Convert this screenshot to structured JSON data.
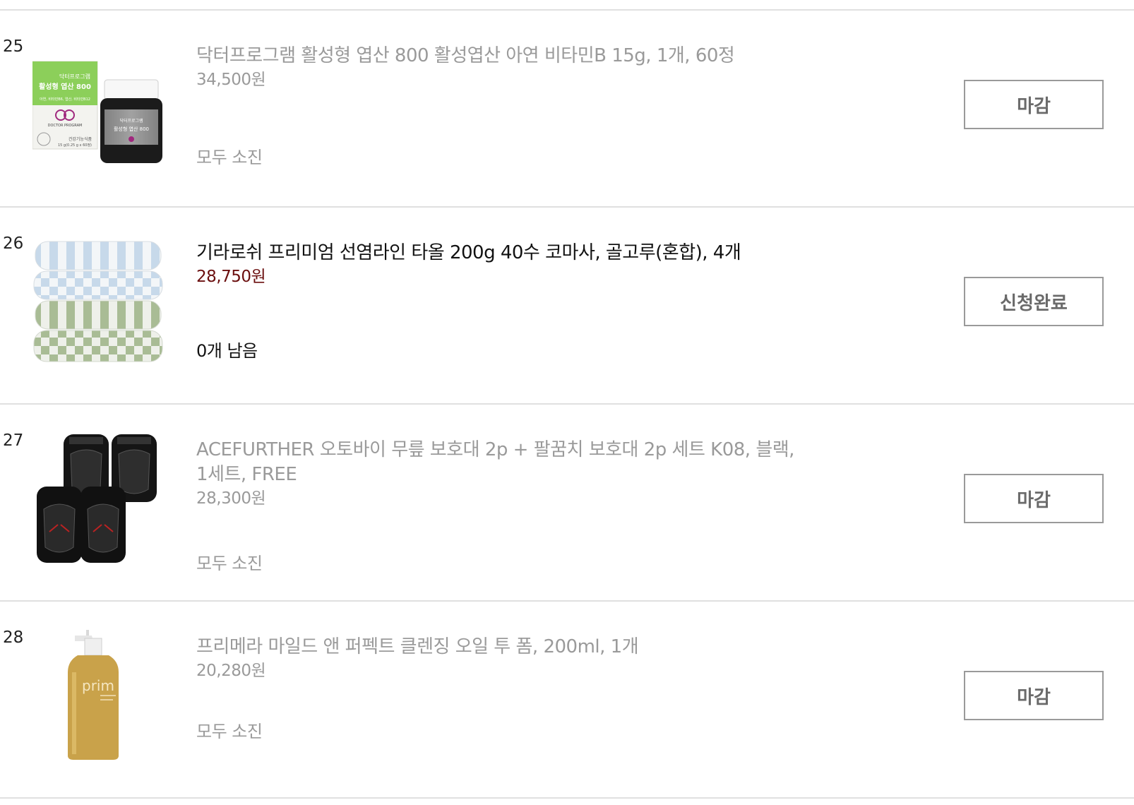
{
  "items": [
    {
      "rank": "25",
      "title": "닥터프로그램 활성형 엽산 800 활성엽산 아연 비타민B 15g, 1개, 60정",
      "price": "34,500원",
      "stock": "모두 소진",
      "button": "마감",
      "status": "closed",
      "image": "supplement-box-and-bottle",
      "box_texts": [
        "닥터프로그램",
        "활성형 엽산 800",
        "아연, 비타민B6, 엽산, 비타민B12",
        "DOCTOR PROGRAM",
        "건강기능식품",
        "15 g(0.25 g x 60정)"
      ],
      "bottle_texts": [
        "닥터프로그램",
        "활성형 엽산 800"
      ]
    },
    {
      "rank": "26",
      "title": "기라로쉬 프리미엄 선염라인 타올 200g 40수 코마사, 골고루(혼합), 4개",
      "price": "28,750원",
      "stock": "0개 남음",
      "button": "신청완료",
      "status": "applied",
      "image": "stacked-towels"
    },
    {
      "rank": "27",
      "title": "ACEFURTHER 오토바이 무릎 보호대 2p + 팔꿈치 보호대 2p 세트 K08, 블랙, 1세트, FREE",
      "price": "28,300원",
      "stock": "모두 소진",
      "button": "마감",
      "status": "closed",
      "image": "knee-elbow-guards"
    },
    {
      "rank": "28",
      "title": "프리메라 마일드 앤 퍼펙트 클렌징 오일 투 폼, 200ml, 1개",
      "price": "20,280원",
      "stock": "모두 소진",
      "button": "마감",
      "status": "closed",
      "image": "cleansing-oil-bottle",
      "bottle_logo": "prim"
    }
  ],
  "colors": {
    "muted_text": "#9a9a9a",
    "active_text": "#111111",
    "active_price": "#6b0f0f",
    "button_border": "#9a9a9a",
    "button_text": "#6a6a6a",
    "divider": "#e0e0e0"
  }
}
